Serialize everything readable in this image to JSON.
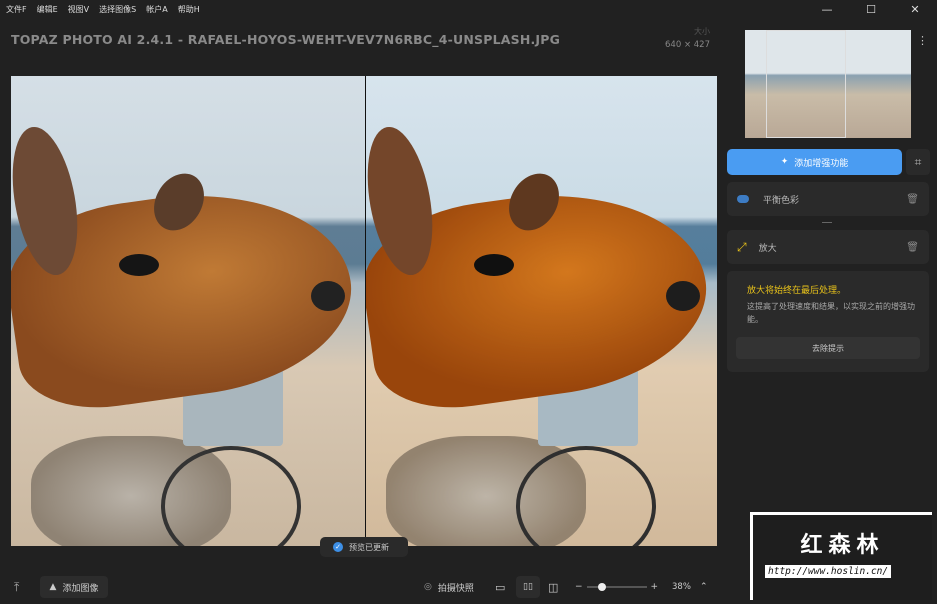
{
  "menu": [
    "文件F",
    "编辑E",
    "视图V",
    "选择图像S",
    "帐户A",
    "帮助H"
  ],
  "window": {
    "minimize": "—",
    "maximize": "☐",
    "close": "✕"
  },
  "title": "TOPAZ PHOTO AI 2.4.1 - RAFAEL-HOYOS-WEHT-VEV7N6RBC_4-UNSPLASH.JPG",
  "size": {
    "label": "大小",
    "value": "640 × 427"
  },
  "toast": "预览已更新",
  "panel": {
    "add_label": "添加增强功能",
    "filters": [
      {
        "label": "平衡色彩"
      },
      {
        "label": "放大"
      }
    ],
    "tip": {
      "title": "放大将始终在最后处理。",
      "body": "这提高了处理速度和结果，以实现之前的增强功能。",
      "dismiss": "去除提示"
    }
  },
  "bottom": {
    "add_image": "添加图像",
    "snapshot": "拍摄快照",
    "zoom": "38%",
    "zoom_level": 0.38
  },
  "watermark": {
    "title": "红森林",
    "url": "http://www.hoslin.cn/"
  },
  "colors": {
    "accent": "#4a9cf2",
    "warning": "#e8c21a"
  }
}
